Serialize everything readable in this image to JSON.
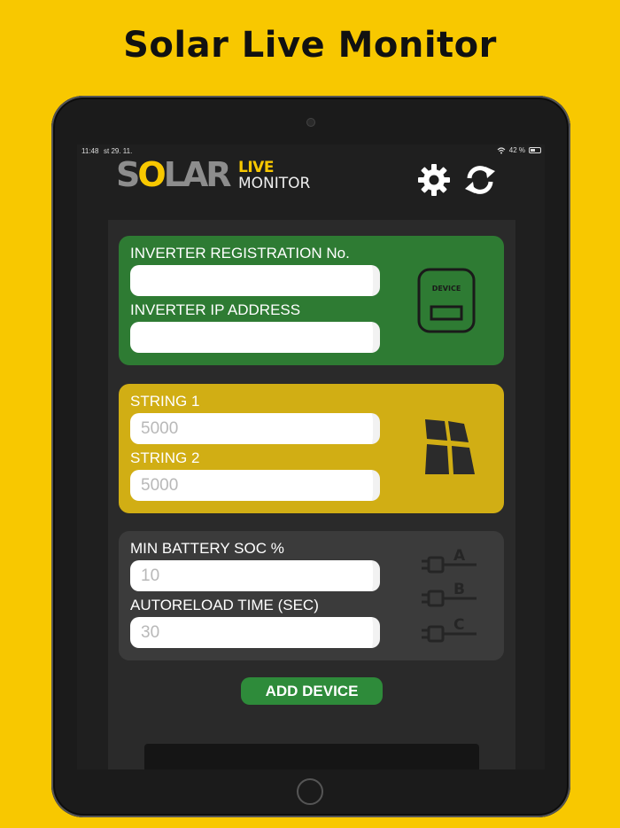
{
  "headline": "Solar Live Monitor",
  "status_bar": {
    "time": "11:48",
    "date": "st 29. 11.",
    "battery": "42 %"
  },
  "logo": {
    "solar_s": "S",
    "solar_o": "O",
    "solar_rest": "LAR",
    "live": "LIVE",
    "monitor": "MONITOR"
  },
  "header_icons": [
    "gear-icon",
    "refresh-icon"
  ],
  "inverter_card": {
    "color": "#2e7b33",
    "registration_label": "INVERTER REGISTRATION No.",
    "registration_value": "",
    "ip_label": "INVERTER IP ADDRESS",
    "ip_value": "",
    "icon_text": "DEVICE"
  },
  "string_card": {
    "color": "#d1ae14",
    "string1_label": "STRING 1",
    "string1_placeholder": "5000",
    "string2_label": "STRING 2",
    "string2_placeholder": "5000"
  },
  "battery_card": {
    "color": "#3b3b3b",
    "soc_label": "MIN BATTERY SOC %",
    "soc_placeholder": "10",
    "autoreload_label": "AUTORELOAD TIME (SEC)",
    "autoreload_placeholder": "30",
    "plug_labels": [
      "A",
      "B",
      "C"
    ]
  },
  "add_device_label": "ADD DEVICE"
}
